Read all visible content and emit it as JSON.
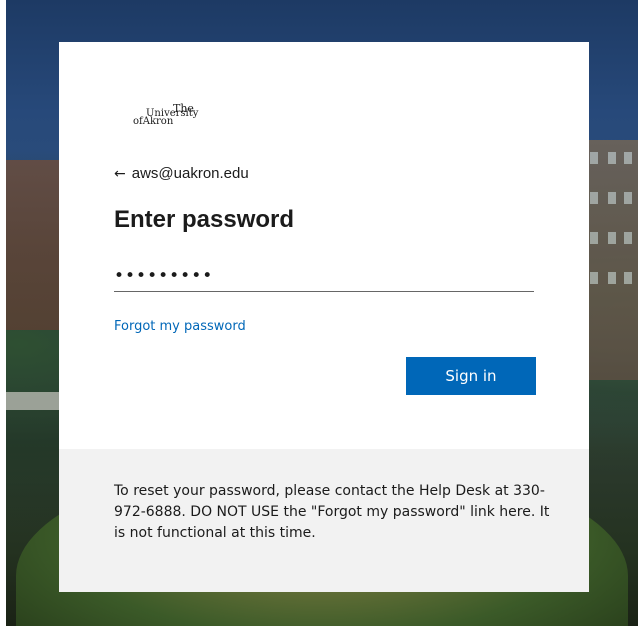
{
  "background": {
    "description_icon": "campus-photo-background"
  },
  "logo": {
    "line1": "The",
    "line2_prefix": "",
    "line2": "University",
    "line3_prefix": "of",
    "line3": "Akron"
  },
  "back": {
    "arrow": "←",
    "identity": "aws@uakron.edu"
  },
  "form": {
    "title": "Enter password",
    "password_value": "•••••••••",
    "forgot_link": "Forgot my password",
    "signin_label": "Sign in"
  },
  "footer": {
    "notice": "To reset your password, please contact the Help Desk at 330-972-6888. DO NOT USE the \"Forgot my password\" link here. It is not functional at this time."
  },
  "colors": {
    "accent": "#0067b8",
    "text": "#1b1b1b",
    "footer_bg": "#f2f2f2"
  }
}
